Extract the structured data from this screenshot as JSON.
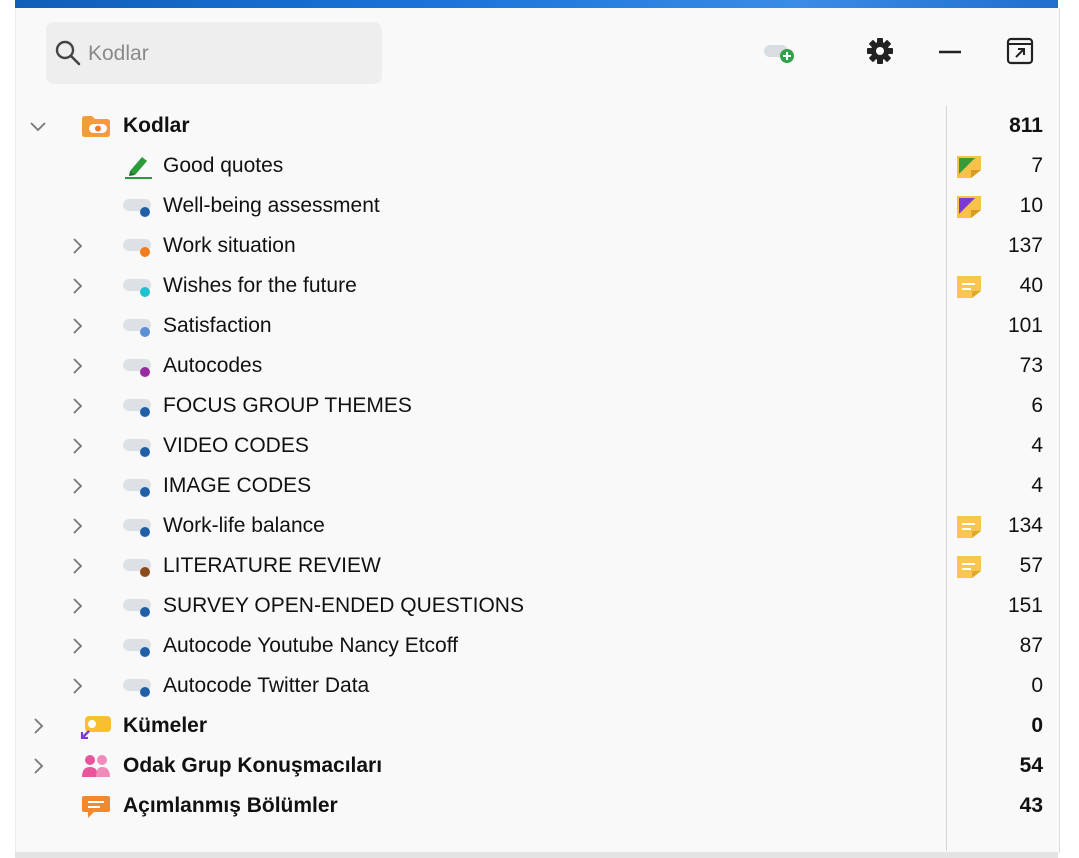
{
  "search": {
    "placeholder": "Kodlar"
  },
  "toolbar": {
    "new_code_icon": "add-code-icon",
    "settings_icon": "gear-icon",
    "minimize_icon": "minus-icon",
    "popout_icon": "popout-icon"
  },
  "root": {
    "label": "Kodlar",
    "count": "811"
  },
  "codes": [
    {
      "label": "Good quotes",
      "count": "7",
      "color": "#3a9a3a",
      "memo": "green"
    },
    {
      "label": "Well-being assessment",
      "count": "10",
      "color": "#1f5fa8",
      "memo": "purple"
    },
    {
      "label": "Work situation",
      "count": "137",
      "color": "#f07d1e",
      "memo": ""
    },
    {
      "label": "Wishes for the future",
      "count": "40",
      "color": "#1ec2d0",
      "memo": "note"
    },
    {
      "label": "Satisfaction",
      "count": "101",
      "color": "#5b8fd6",
      "memo": ""
    },
    {
      "label": "Autocodes",
      "count": "73",
      "color": "#9a2aa0",
      "memo": ""
    },
    {
      "label": "FOCUS GROUP THEMES",
      "count": "6",
      "color": "#1f5fa8",
      "memo": ""
    },
    {
      "label": "VIDEO CODES",
      "count": "4",
      "color": "#1f5fa8",
      "memo": ""
    },
    {
      "label": "IMAGE CODES",
      "count": "4",
      "color": "#1f5fa8",
      "memo": ""
    },
    {
      "label": "Work-life balance",
      "count": "134",
      "color": "#1f5fa8",
      "memo": "note"
    },
    {
      "label": "LITERATURE REVIEW",
      "count": "57",
      "color": "#8a4a1c",
      "memo": "note"
    },
    {
      "label": "SURVEY OPEN-ENDED QUESTIONS",
      "count": "151",
      "color": "#1f5fa8",
      "memo": ""
    },
    {
      "label": "Autocode Youtube Nancy Etcoff",
      "count": "87",
      "color": "#1f5fa8",
      "memo": ""
    },
    {
      "label": "Autocode Twitter Data",
      "count": "0",
      "color": "#1f5fa8",
      "memo": ""
    }
  ],
  "sections": [
    {
      "label": "Kümeler",
      "count": "0",
      "icon": "code-set-icon"
    },
    {
      "label": "Odak Grup Konuşmacıları",
      "count": "54",
      "icon": "speakers-icon"
    },
    {
      "label": "Açımlanmış Bölümler",
      "count": "43",
      "icon": "comment-icon"
    }
  ]
}
